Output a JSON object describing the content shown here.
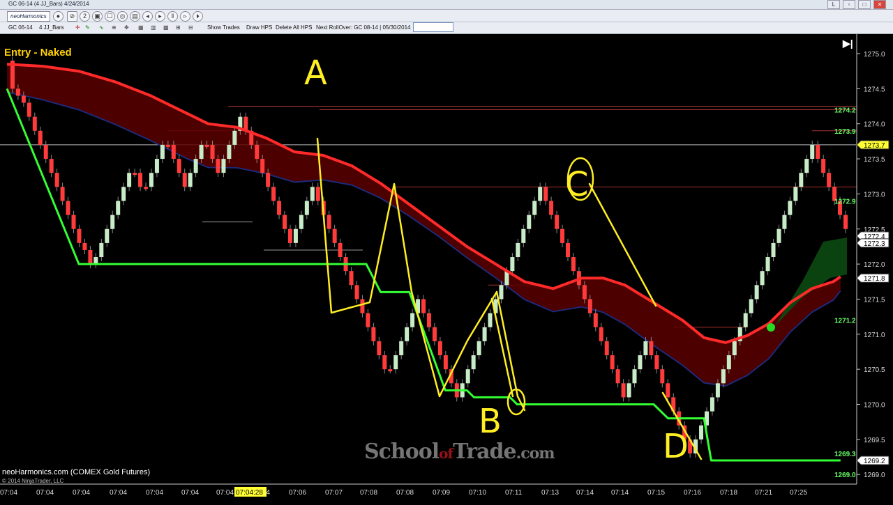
{
  "window": {
    "title": "GC 06-14 (4 JJ_Bars)  4/24/2014"
  },
  "toolbar": {
    "brand": "neoHarmonics",
    "instrument": "GC 06-14",
    "bar_type": "4 JJ_Bars",
    "show_trades": "Show Trades",
    "draw_hps": "Draw HPS",
    "delete_hps": "Delete All HPS",
    "next_rollover": "Next RollOver: GC 08-14 | 05/30/2014"
  },
  "chart": {
    "entry_label": "Entry - Naked",
    "footer_label": "neoHarmonics.com (COMEX Gold Futures)",
    "copyright": "© 2014 NinjaTrader, LLC",
    "watermark": {
      "part1": "School",
      "part2": "of",
      "part3": "Trade",
      "part4": ".com"
    },
    "annotations": [
      "A",
      "B",
      "C",
      "D"
    ]
  },
  "chart_data": {
    "type": "line",
    "title": "Entry - Naked",
    "xlabel": "",
    "ylabel": "",
    "ylim": [
      1268.9,
      1275.3
    ],
    "price_ticks": [
      "1275.0",
      "1274.5",
      "1274.0",
      "1273.5",
      "1273.0",
      "1272.5",
      "1272.0",
      "1271.5",
      "1271.0",
      "1270.5",
      "1270.0",
      "1269.5",
      "1269.0"
    ],
    "time_ticks": [
      "07:04",
      "07:04",
      "07:04",
      "07:04",
      "07:04",
      "07:04",
      "07:04",
      "07:04",
      "07:06",
      "07:07",
      "07:08",
      "07:08",
      "07:09",
      "07:10",
      "07:11",
      "07:13",
      "07:14",
      "07:14",
      "07:15",
      "07:16",
      "07:18",
      "07:21",
      "07:25"
    ],
    "time_highlight": "07:04:28",
    "price_labels": [
      {
        "value": 1274.2,
        "text": "1274.2",
        "color": "#66ff66"
      },
      {
        "value": 1273.9,
        "text": "1273.9",
        "color": "#66ff66"
      },
      {
        "value": 1272.9,
        "text": "1272.9",
        "color": "#66ff66"
      },
      {
        "value": 1271.2,
        "text": "1271.2",
        "color": "#66ff66"
      },
      {
        "value": 1269.3,
        "text": "1269.3",
        "color": "#66ff66"
      },
      {
        "value": 1269.0,
        "text": "1269.0",
        "color": "#66ff66"
      }
    ],
    "price_boxes": [
      {
        "value": 1273.7,
        "text": "1273.7",
        "bg": "#ffff33",
        "fg": "#000"
      },
      {
        "value": 1272.4,
        "text": "1272.4",
        "bg": "#ffffff",
        "fg": "#000"
      },
      {
        "value": 1272.3,
        "text": "1272.3",
        "bg": "#ffffff",
        "fg": "#000"
      },
      {
        "value": 1271.8,
        "text": "1271.8",
        "bg": "#ffffff",
        "fg": "#000"
      },
      {
        "value": 1269.2,
        "text": "1269.2",
        "bg": "#ffffff",
        "fg": "#000"
      }
    ],
    "series": [
      {
        "name": "",
        "color": "#ff2a2a",
        "values": [
          [
            0,
            1274.85
          ],
          [
            5,
            1274.82
          ],
          [
            10,
            1274.75
          ],
          [
            15,
            1274.6
          ],
          [
            20,
            1274.4
          ],
          [
            25,
            1274.15
          ],
          [
            28,
            1274.0
          ],
          [
            32,
            1273.95
          ],
          [
            36,
            1273.8
          ],
          [
            40,
            1273.6
          ],
          [
            44,
            1273.55
          ],
          [
            48,
            1273.4
          ],
          [
            52,
            1273.15
          ],
          [
            56,
            1272.85
          ],
          [
            60,
            1272.55
          ],
          [
            64,
            1272.25
          ],
          [
            68,
            1272.0
          ],
          [
            72,
            1271.75
          ],
          [
            76,
            1271.65
          ],
          [
            80,
            1271.8
          ],
          [
            83,
            1271.8
          ],
          [
            86,
            1271.7
          ],
          [
            90,
            1271.45
          ],
          [
            94,
            1271.2
          ],
          [
            97,
            1270.95
          ],
          [
            100,
            1270.88
          ],
          [
            103,
            1270.98
          ],
          [
            106,
            1271.15
          ],
          [
            109,
            1271.45
          ],
          [
            112,
            1271.65
          ],
          [
            115,
            1271.75
          ],
          [
            116,
            1271.82
          ]
        ]
      },
      {
        "name": "",
        "color": "#33ff33",
        "values": [
          [
            0,
            1274.5
          ],
          [
            10,
            1272.0
          ],
          [
            50,
            1272.0
          ],
          [
            52,
            1271.6
          ],
          [
            56,
            1271.6
          ],
          [
            61,
            1270.2
          ],
          [
            64,
            1270.2
          ],
          [
            65,
            1270.1
          ],
          [
            70,
            1270.1
          ],
          [
            71,
            1270.0
          ],
          [
            90,
            1270.0
          ],
          [
            92,
            1269.8
          ],
          [
            97,
            1269.8
          ],
          [
            98,
            1269.2
          ],
          [
            116,
            1269.2
          ]
        ]
      }
    ]
  }
}
